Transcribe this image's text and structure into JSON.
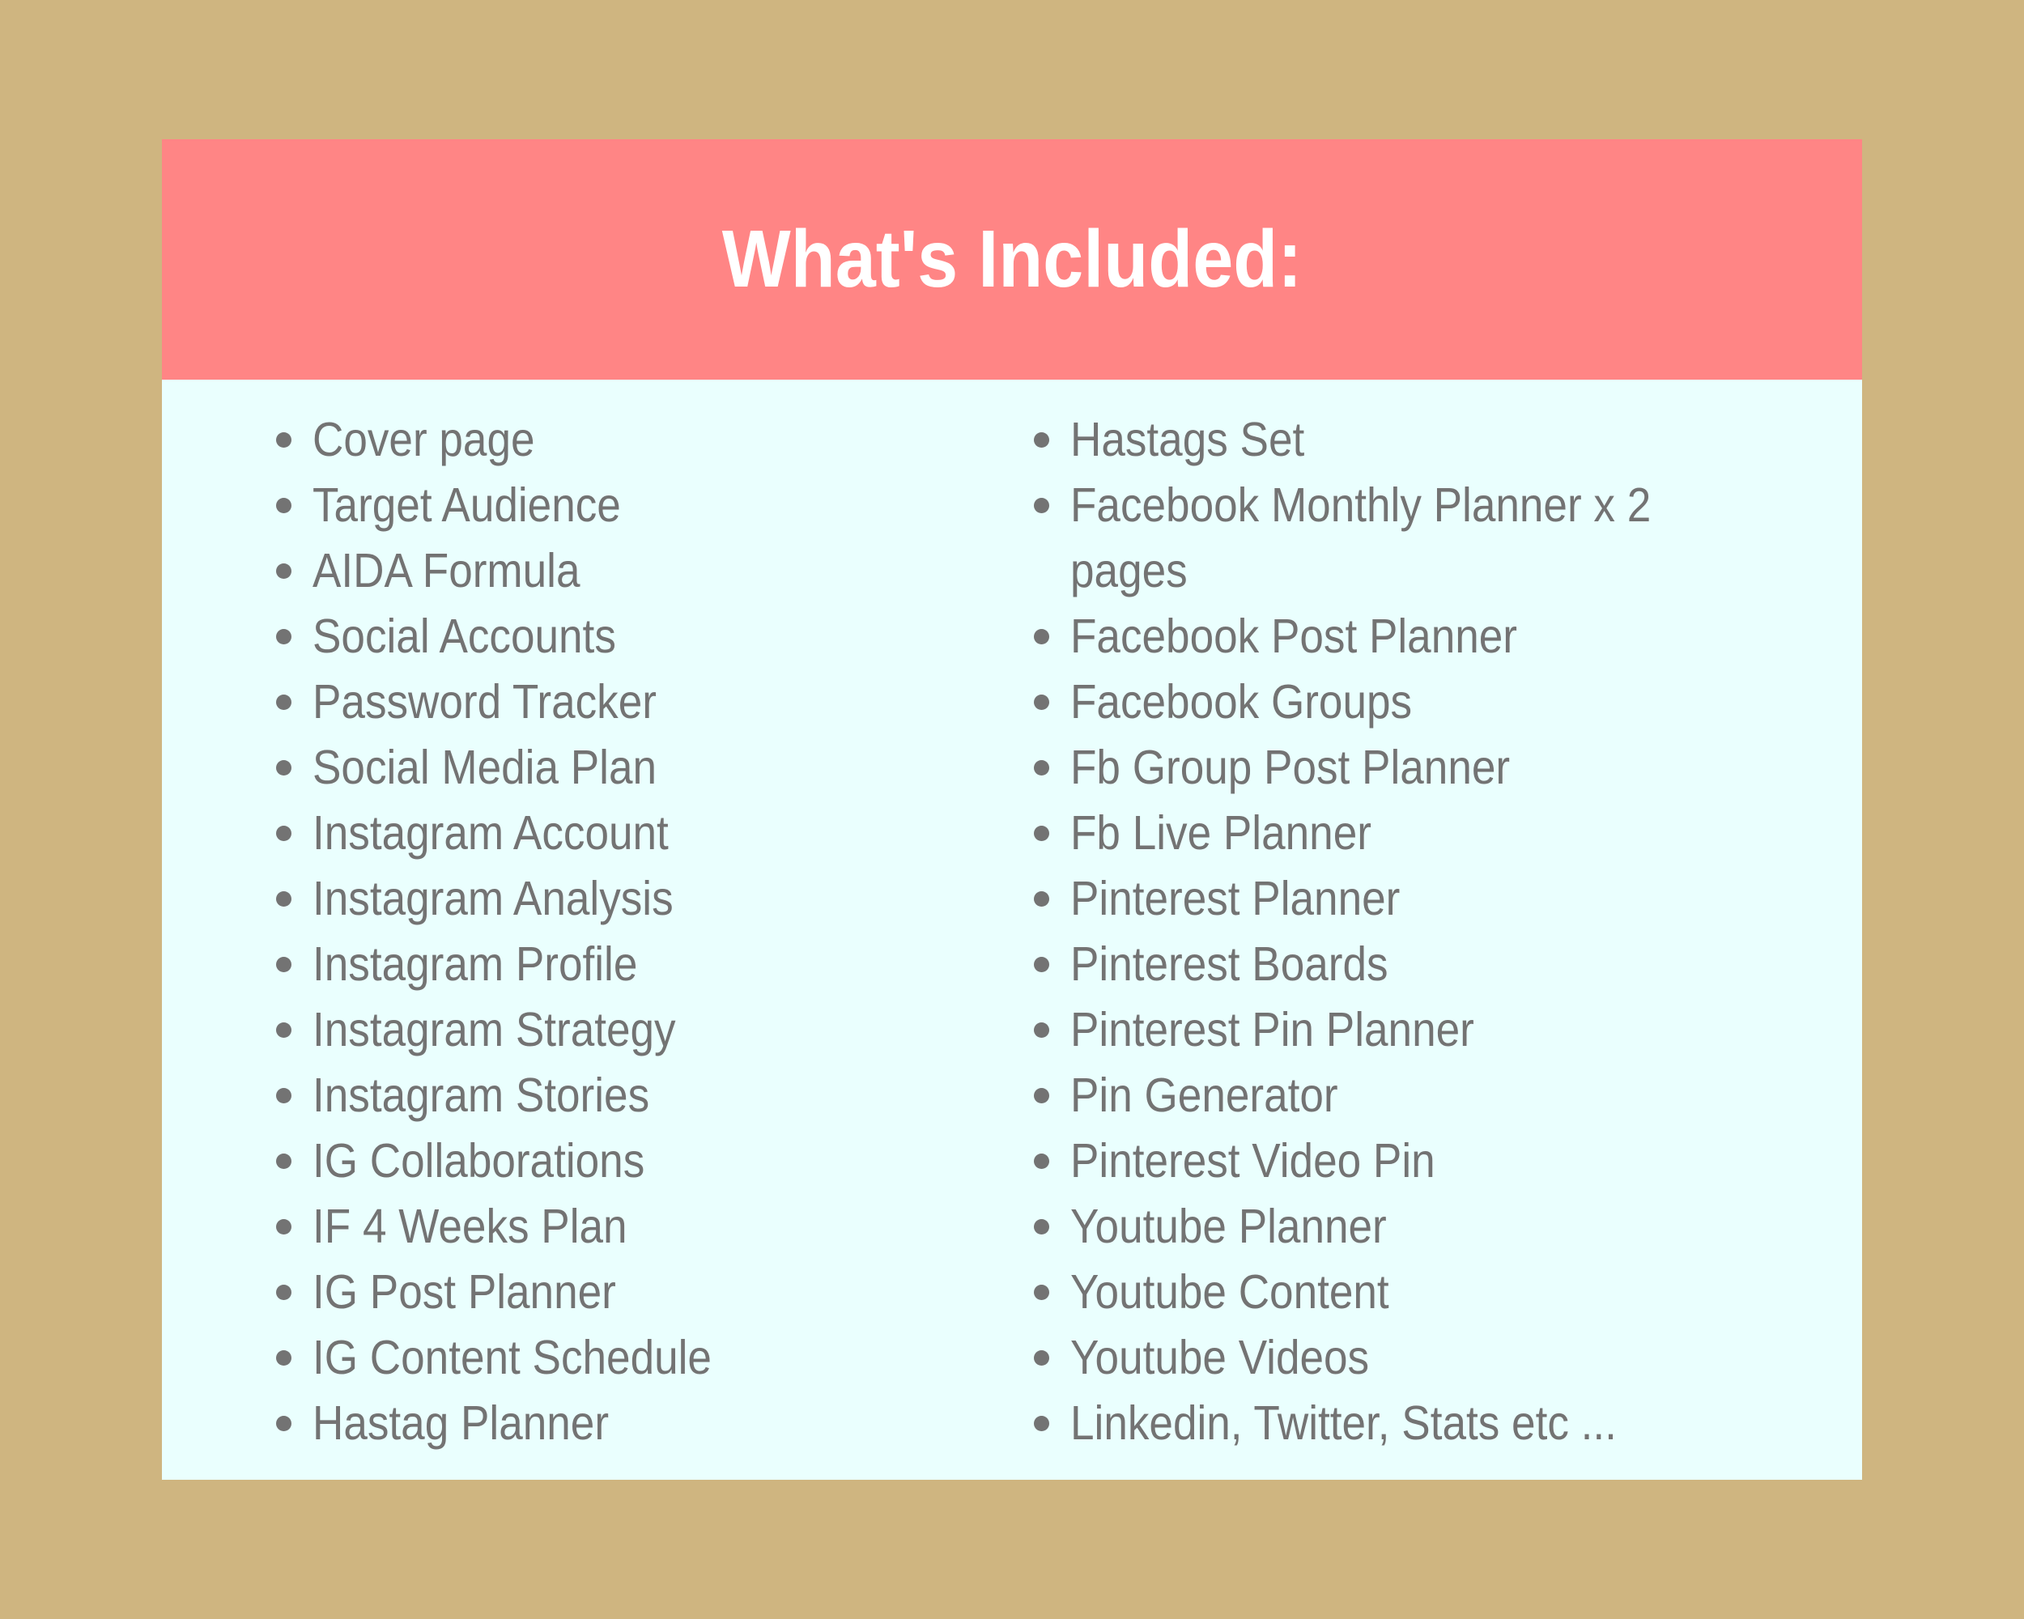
{
  "title": "What's Included:",
  "colors": {
    "page_background": "#CFB580",
    "header_background": "#FF8585",
    "card_background": "#EAFFFE",
    "text": "#737373",
    "title_text": "#FFFFFF"
  },
  "icons": {
    "bullet": "bullet-icon"
  },
  "left_column": [
    "Cover page",
    "Target Audience",
    "AIDA Formula",
    "Social Accounts",
    "Password Tracker",
    "Social Media Plan",
    "Instagram Account",
    "Instagram Analysis",
    "Instagram Profile",
    "Instagram Strategy",
    "Instagram Stories",
    "IG Collaborations",
    "IF 4 Weeks Plan",
    "IG Post Planner",
    "IG Content Schedule",
    "Hastag Planner"
  ],
  "right_column": [
    "Hastags Set",
    "Facebook Monthly Planner x 2 pages",
    "Facebook Post Planner",
    "Facebook Groups",
    "Fb Group Post Planner",
    "Fb Live Planner",
    "Pinterest Planner",
    "Pinterest Boards",
    "Pinterest Pin Planner",
    "Pin Generator",
    "Pinterest Video Pin",
    "Youtube Planner",
    "Youtube Content",
    "Youtube Videos",
    "Linkedin, Twitter, Stats etc ..."
  ]
}
